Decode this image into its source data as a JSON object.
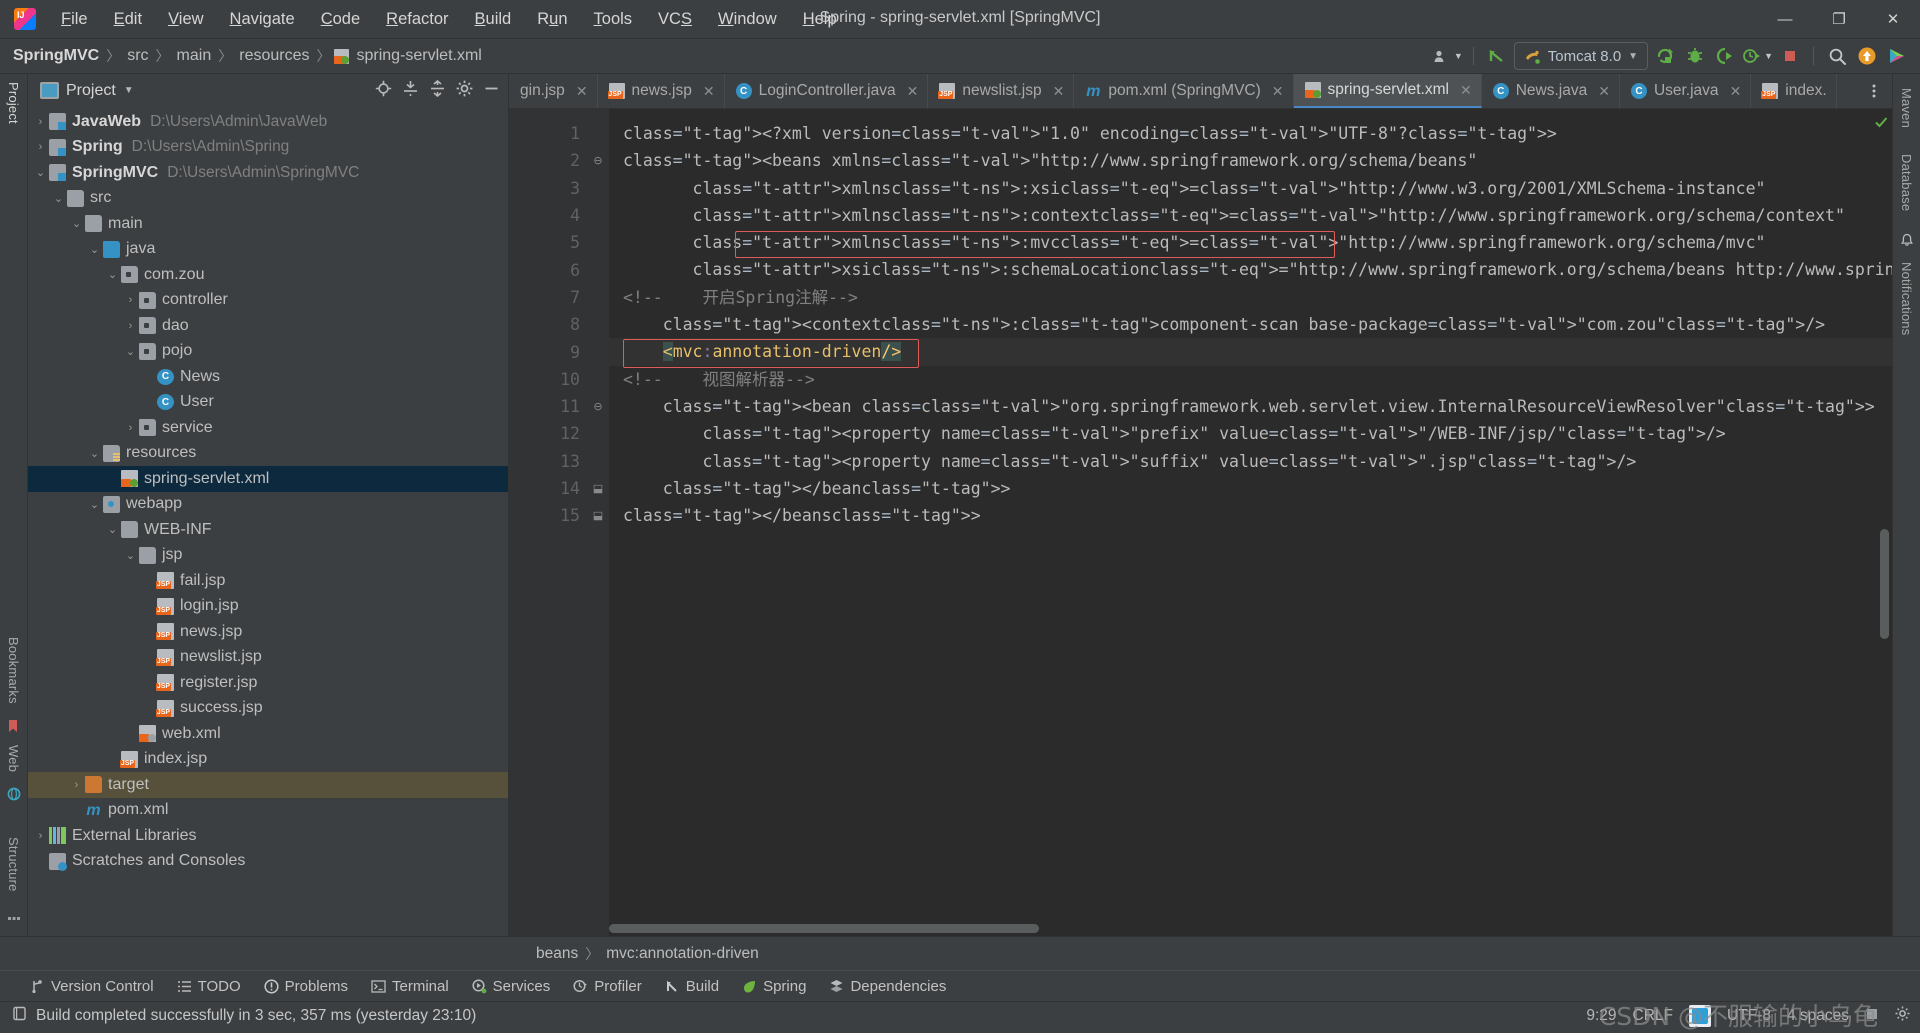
{
  "window": {
    "title": "Spring - spring-servlet.xml [SpringMVC]",
    "minimize": "—",
    "maximize": "❐",
    "close": "✕"
  },
  "menubar": [
    {
      "label": "File"
    },
    {
      "label": "Edit"
    },
    {
      "label": "View"
    },
    {
      "label": "Navigate"
    },
    {
      "label": "Code"
    },
    {
      "label": "Refactor"
    },
    {
      "label": "Build"
    },
    {
      "label": "Run"
    },
    {
      "label": "Tools"
    },
    {
      "label": "VCS"
    },
    {
      "label": "Window"
    },
    {
      "label": "Help"
    }
  ],
  "breadcrumb": {
    "items": [
      "SpringMVC",
      "src",
      "main",
      "resources",
      "spring-servlet.xml"
    ],
    "separator": "〉"
  },
  "toolbar": {
    "run_config": "Tomcat 8.0",
    "chevron": "▼",
    "icons": [
      "user-dropdown-icon",
      "update-project-icon",
      "run-icon",
      "debug-icon",
      "run-coverage-icon",
      "profiler-icon",
      "stop-icon",
      "search-everywhere-icon",
      "updates-icon",
      "ide-icon"
    ]
  },
  "rail_left": {
    "top": [
      "Project"
    ],
    "bottom": [
      "Bookmarks",
      "Web",
      "Structure"
    ]
  },
  "rail_right": [
    "Maven",
    "Database",
    "Notifications"
  ],
  "project_panel": {
    "title": "Project",
    "dropdown": "▼",
    "tools": [
      "locate-icon",
      "expand-all-icon",
      "collapse-all-icon",
      "settings-icon",
      "hide-icon"
    ],
    "tree": [
      {
        "label": "JavaWeb",
        "path": "D:\\Users\\Admin\\JavaWeb",
        "indent": 0,
        "arrow": "›",
        "icon": "module-icon",
        "bold": true
      },
      {
        "label": "Spring",
        "path": "D:\\Users\\Admin\\Spring",
        "indent": 0,
        "arrow": "›",
        "icon": "module-icon",
        "bold": true
      },
      {
        "label": "SpringMVC",
        "path": "D:\\Users\\Admin\\SpringMVC",
        "indent": 0,
        "arrow": "⌄",
        "icon": "module-icon",
        "bold": true
      },
      {
        "label": "src",
        "path": "",
        "indent": 1,
        "arrow": "⌄",
        "icon": "folder-icon",
        "bold": false
      },
      {
        "label": "main",
        "path": "",
        "indent": 2,
        "arrow": "⌄",
        "icon": "folder-icon",
        "bold": false
      },
      {
        "label": "java",
        "path": "",
        "indent": 3,
        "arrow": "⌄",
        "icon": "source-folder-icon",
        "bold": false
      },
      {
        "label": "com.zou",
        "path": "",
        "indent": 4,
        "arrow": "⌄",
        "icon": "package-icon",
        "bold": false
      },
      {
        "label": "controller",
        "path": "",
        "indent": 5,
        "arrow": "›",
        "icon": "package-icon",
        "bold": false
      },
      {
        "label": "dao",
        "path": "",
        "indent": 5,
        "arrow": "›",
        "icon": "package-icon",
        "bold": false
      },
      {
        "label": "pojo",
        "path": "",
        "indent": 5,
        "arrow": "⌄",
        "icon": "package-icon",
        "bold": false
      },
      {
        "label": "News",
        "path": "",
        "indent": 6,
        "arrow": "",
        "icon": "java-class-icon",
        "bold": false
      },
      {
        "label": "User",
        "path": "",
        "indent": 6,
        "arrow": "",
        "icon": "java-class-icon",
        "bold": false
      },
      {
        "label": "service",
        "path": "",
        "indent": 5,
        "arrow": "›",
        "icon": "package-icon",
        "bold": false
      },
      {
        "label": "resources",
        "path": "",
        "indent": 3,
        "arrow": "⌄",
        "icon": "resources-folder-icon",
        "bold": false
      },
      {
        "label": "spring-servlet.xml",
        "path": "",
        "indent": 4,
        "arrow": "",
        "icon": "spring-xml-icon",
        "bold": false,
        "selected": true
      },
      {
        "label": "webapp",
        "path": "",
        "indent": 3,
        "arrow": "⌄",
        "icon": "web-folder-icon",
        "bold": false
      },
      {
        "label": "WEB-INF",
        "path": "",
        "indent": 4,
        "arrow": "⌄",
        "icon": "folder-icon",
        "bold": false
      },
      {
        "label": "jsp",
        "path": "",
        "indent": 5,
        "arrow": "⌄",
        "icon": "folder-icon",
        "bold": false
      },
      {
        "label": "fail.jsp",
        "path": "",
        "indent": 6,
        "arrow": "",
        "icon": "jsp-icon",
        "bold": false
      },
      {
        "label": "login.jsp",
        "path": "",
        "indent": 6,
        "arrow": "",
        "icon": "jsp-icon",
        "bold": false
      },
      {
        "label": "news.jsp",
        "path": "",
        "indent": 6,
        "arrow": "",
        "icon": "jsp-icon",
        "bold": false
      },
      {
        "label": "newslist.jsp",
        "path": "",
        "indent": 6,
        "arrow": "",
        "icon": "jsp-icon",
        "bold": false
      },
      {
        "label": "register.jsp",
        "path": "",
        "indent": 6,
        "arrow": "",
        "icon": "jsp-icon",
        "bold": false
      },
      {
        "label": "success.jsp",
        "path": "",
        "indent": 6,
        "arrow": "",
        "icon": "jsp-icon",
        "bold": false
      },
      {
        "label": "web.xml",
        "path": "",
        "indent": 5,
        "arrow": "",
        "icon": "web-xml-icon",
        "bold": false
      },
      {
        "label": "index.jsp",
        "path": "",
        "indent": 4,
        "arrow": "",
        "icon": "jsp-icon",
        "bold": false
      },
      {
        "label": "target",
        "path": "",
        "indent": 2,
        "arrow": "›",
        "icon": "excluded-folder-icon",
        "bold": false,
        "tan": true
      },
      {
        "label": "pom.xml",
        "path": "",
        "indent": 2,
        "arrow": "",
        "icon": "maven-icon",
        "bold": false
      },
      {
        "label": "External Libraries",
        "path": "",
        "indent": 0,
        "arrow": "›",
        "icon": "libraries-icon",
        "bold": false
      },
      {
        "label": "Scratches and Consoles",
        "path": "",
        "indent": 0,
        "arrow": "",
        "icon": "scratches-icon",
        "bold": false
      }
    ]
  },
  "tabs": [
    {
      "label": "gin.jsp",
      "icon": "jsp-icon",
      "active": false,
      "clipped": true
    },
    {
      "label": "news.jsp",
      "icon": "jsp-icon",
      "active": false
    },
    {
      "label": "LoginController.java",
      "icon": "java-class-icon",
      "active": false
    },
    {
      "label": "newslist.jsp",
      "icon": "jsp-icon",
      "active": false
    },
    {
      "label": "pom.xml (SpringMVC)",
      "icon": "maven-icon",
      "active": false
    },
    {
      "label": "spring-servlet.xml",
      "icon": "spring-xml-icon",
      "active": true
    },
    {
      "label": "News.java",
      "icon": "java-class-icon",
      "active": false
    },
    {
      "label": "User.java",
      "icon": "java-class-icon",
      "active": false
    },
    {
      "label": "index.",
      "icon": "jsp-icon",
      "active": false,
      "clipped": true
    }
  ],
  "editor": {
    "filename": "spring-servlet.xml",
    "line_numbers": [
      "1",
      "2",
      "3",
      "4",
      "5",
      "6",
      "7",
      "8",
      "9",
      "10",
      "11",
      "12",
      "13",
      "14",
      "15"
    ],
    "lines": [
      {
        "n": 1,
        "raw": "<?xml version=\"1.0\" encoding=\"UTF-8\"?>"
      },
      {
        "n": 2,
        "raw": "<beans xmlns=\"http://www.springframework.org/schema/beans\""
      },
      {
        "n": 3,
        "raw": "       xmlns:xsi=\"http://www.w3.org/2001/XMLSchema-instance\""
      },
      {
        "n": 4,
        "raw": "       xmlns:context=\"http://www.springframework.org/schema/context\""
      },
      {
        "n": 5,
        "raw": "       xmlns:mvc=\"http://www.springframework.org/schema/mvc\""
      },
      {
        "n": 6,
        "raw": "       xsi:schemaLocation=\"http://www.springframework.org/schema/beans http://www.springframework.org/schema/beans/spring-beans.xsd"
      },
      {
        "n": 7,
        "raw": "<!--    开启Spring注解-->"
      },
      {
        "n": 8,
        "raw": "    <context:component-scan base-package=\"com.zou\"/>"
      },
      {
        "n": 9,
        "raw": "    <mvc:annotation-driven/>"
      },
      {
        "n": 10,
        "raw": "<!--    视图解析器-->"
      },
      {
        "n": 11,
        "raw": "    <bean class=\"org.springframework.web.servlet.view.InternalResourceViewResolver\">"
      },
      {
        "n": 12,
        "raw": "        <property name=\"prefix\" value=\"/WEB-INF/jsp/\"/>"
      },
      {
        "n": 13,
        "raw": "        <property name=\"suffix\" value=\".jsp\"/>"
      },
      {
        "n": 14,
        "raw": "    </bean>"
      },
      {
        "n": 15,
        "raw": "</beans>"
      }
    ],
    "gutter_icons": [
      {
        "line": 2,
        "name": "spring-bean-icon"
      },
      {
        "line": 8,
        "name": "spring-component-scan-icon"
      },
      {
        "line": 9,
        "name": "intention-bulb-icon"
      }
    ],
    "current_line": 9
  },
  "bottom_breadcrumb": {
    "items": [
      "beans",
      "mvc:annotation-driven"
    ],
    "separator": "〉"
  },
  "tool_windows": [
    {
      "label": "Version Control",
      "icon": "branch-icon"
    },
    {
      "label": "TODO",
      "icon": "todo-icon"
    },
    {
      "label": "Problems",
      "icon": "problems-icon"
    },
    {
      "label": "Terminal",
      "icon": "terminal-icon"
    },
    {
      "label": "Services",
      "icon": "services-icon"
    },
    {
      "label": "Profiler",
      "icon": "profiler-icon"
    },
    {
      "label": "Build",
      "icon": "build-icon"
    },
    {
      "label": "Spring",
      "icon": "spring-leaf-icon"
    },
    {
      "label": "Dependencies",
      "icon": "dependencies-icon"
    }
  ],
  "statusbar": {
    "message": "Build completed successfully in 3 sec, 357 ms (yesterday 23:10)",
    "caret": "9:29",
    "line_sep": "CRLF",
    "encoding": "UTF-8",
    "indent": "4 spaces",
    "watermark": "CSDN @不服输的小乌龟"
  },
  "colors": {
    "accent": "#4a88c7",
    "selection": "#0d293e",
    "error_box": "#e05c5c",
    "background": "#3c3f41",
    "editor_bg": "#2b2b2b"
  }
}
